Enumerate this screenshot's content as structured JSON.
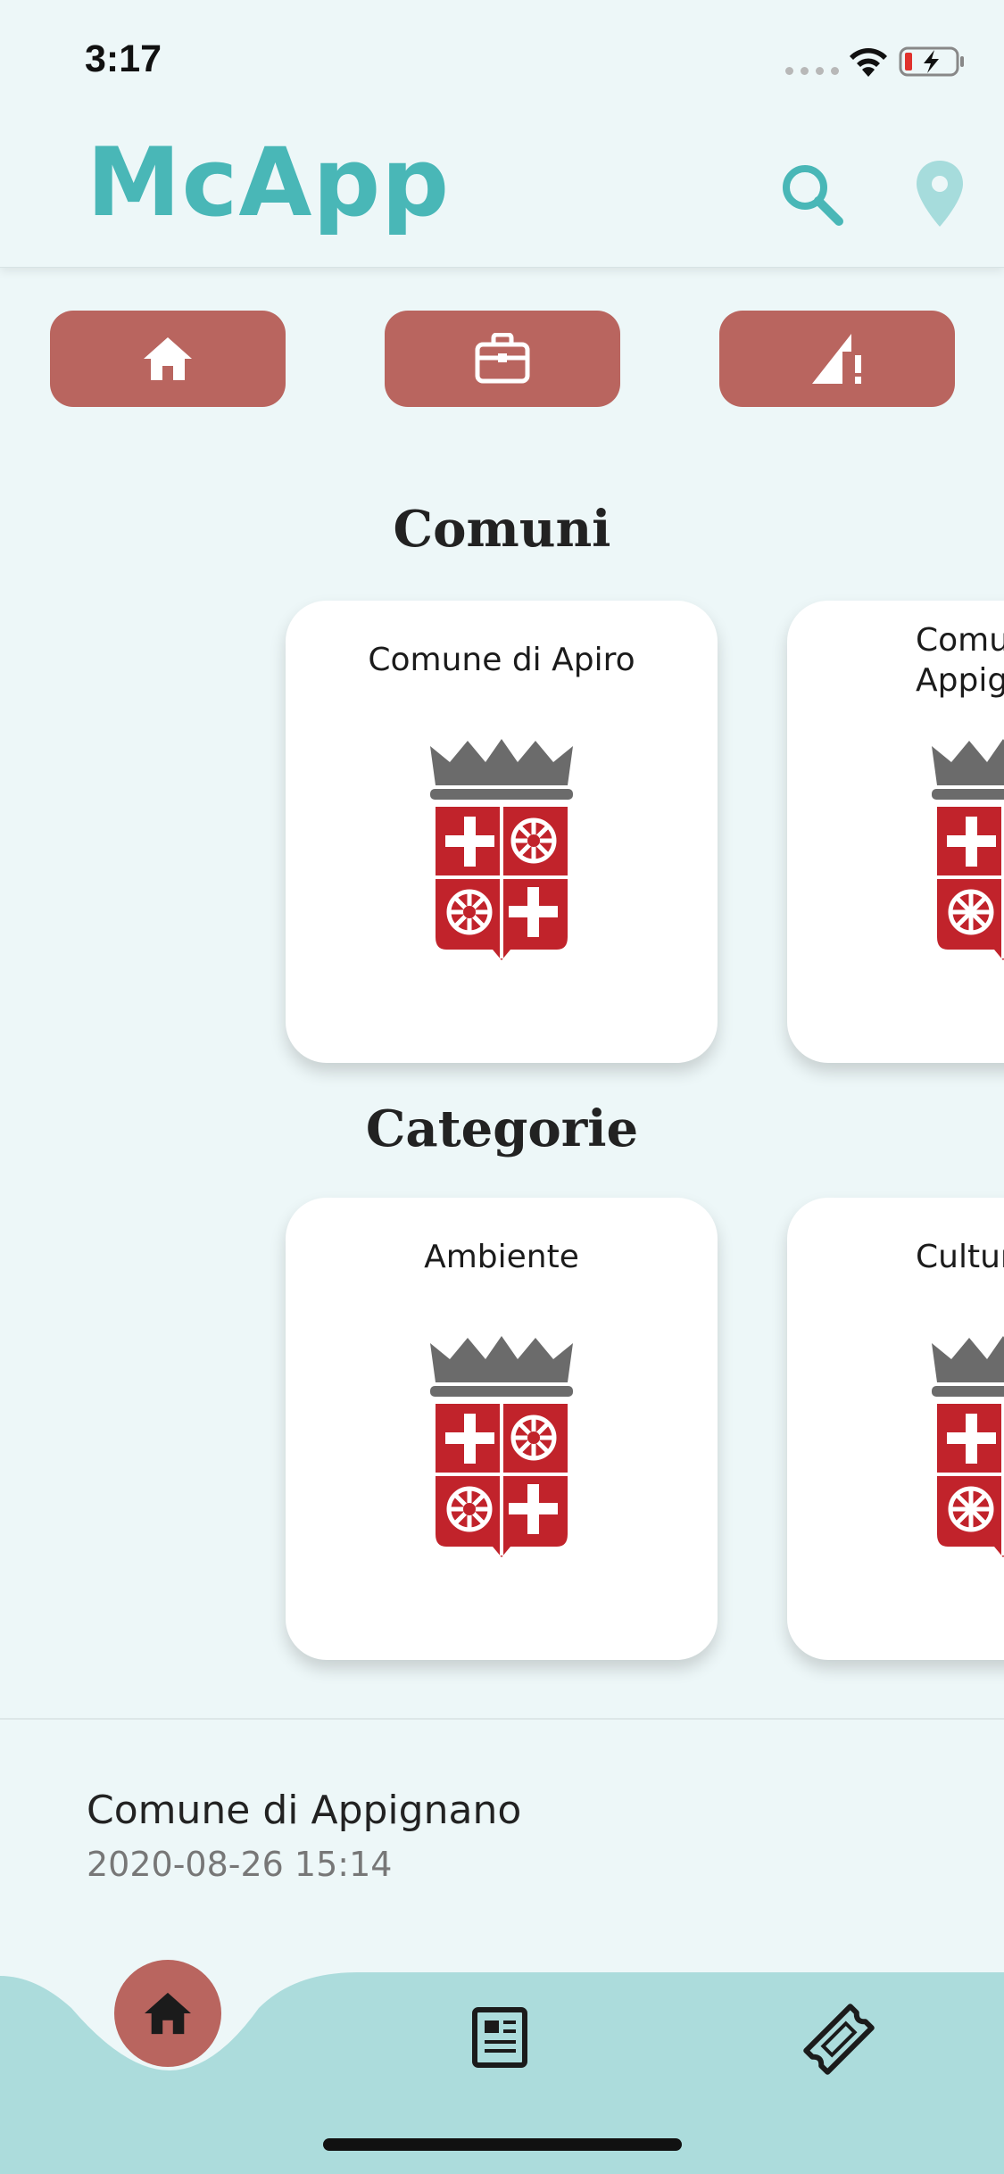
{
  "status": {
    "time": "3:17"
  },
  "header": {
    "title": "McApp"
  },
  "sections": {
    "comuni": {
      "title": "Comuni",
      "cards": [
        {
          "label": "Comune di Apiro"
        },
        {
          "label": "Comune di\nAppignano"
        }
      ]
    },
    "categorie": {
      "title": "Categorie",
      "cards": [
        {
          "label": "Ambiente"
        },
        {
          "label": "Cultura"
        }
      ]
    }
  },
  "notification": {
    "title": "Comune di Appignano",
    "date": "2020-08-26 15:14"
  },
  "colors": {
    "accent": "#49b7b7",
    "button_red": "#b9655f",
    "background": "#edf7f8",
    "nav_bg": "#acdcdc",
    "crest_red": "#c1232b",
    "crown_gray": "#6b6b6b"
  },
  "icons": {
    "top_buttons": [
      "home-icon",
      "briefcase-icon",
      "signal-alert-icon"
    ],
    "bottom_nav": [
      "home-icon",
      "news-icon",
      "ticket-icon"
    ],
    "header": [
      "search-icon",
      "location-pin-icon"
    ]
  }
}
